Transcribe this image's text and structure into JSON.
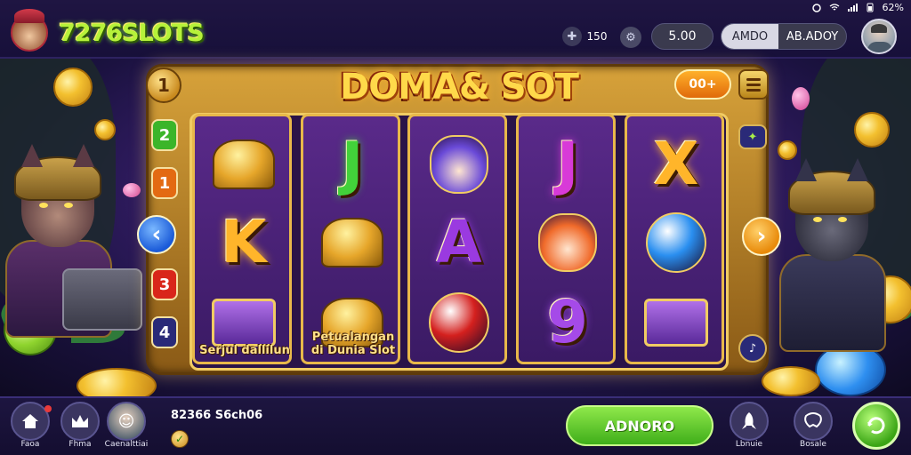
{
  "topbar": {
    "logo_text": "7276SLOTS",
    "status_bar": {
      "battery_text": "62%"
    },
    "lives_count": "150",
    "balance_pill": "5.00",
    "segment_left": "AMDO",
    "segment_right": "AB.ADOY"
  },
  "machine": {
    "title": "DOMA& SOT",
    "bet_label": "00+",
    "corner_number": "1",
    "line_numbers": [
      {
        "label": "2",
        "color": "#3bb52a"
      },
      {
        "label": "1",
        "color": "#e36a12"
      },
      {
        "label": "3",
        "color": "#d9261a"
      },
      {
        "label": "4",
        "color": "#2a2a78"
      }
    ],
    "reels": [
      {
        "symbols": [
          {
            "kind": "bell",
            "icon": "golden-bell-icon"
          },
          {
            "kind": "letter",
            "text": "K",
            "color": "#ffb52a"
          },
          {
            "kind": "chest",
            "icon": "treasure-chest-icon",
            "caption": "Serjul dallilun"
          }
        ]
      },
      {
        "symbols": [
          {
            "kind": "letter",
            "text": "J",
            "color": "#42d23a"
          },
          {
            "kind": "bell",
            "icon": "golden-bell-icon"
          },
          {
            "kind": "bell",
            "icon": "golden-bell-icon",
            "caption": "Petualangan di Dunia Slot"
          }
        ]
      },
      {
        "symbols": [
          {
            "kind": "animal",
            "icon": "wolf-face-icon",
            "color": "#6a4ad8"
          },
          {
            "kind": "letter",
            "text": "A",
            "color": "#9a3ae0"
          },
          {
            "kind": "gem",
            "icon": "red-gem-icon",
            "color": "#d4201e"
          }
        ]
      },
      {
        "symbols": [
          {
            "kind": "letter",
            "text": "J",
            "color": "#d83ad8"
          },
          {
            "kind": "animal",
            "icon": "fox-face-icon",
            "color": "#f06a2a"
          },
          {
            "kind": "letter",
            "text": "9",
            "color": "#a54ae8"
          }
        ]
      },
      {
        "symbols": [
          {
            "kind": "letter",
            "text": "X",
            "color": "#ffb52a"
          },
          {
            "kind": "gem",
            "icon": "blue-swirl-orb-icon",
            "color": "#2a8ff0"
          },
          {
            "kind": "chest",
            "icon": "purple-book-icon"
          }
        ]
      }
    ]
  },
  "bottombar": {
    "nav_items": [
      {
        "label": "Faoa",
        "icon": "home-icon"
      },
      {
        "label": "Fhma",
        "icon": "crown-icon"
      },
      {
        "label": "Caenalttiai",
        "icon": "profile-avatar-icon"
      }
    ],
    "score_text": "82366 S6ch06",
    "play_label": "ADNORO",
    "right_items": [
      {
        "label": "Lbnuie",
        "icon": "rocket-icon"
      },
      {
        "label": "Bosale",
        "icon": "puzzle-icon"
      }
    ]
  }
}
